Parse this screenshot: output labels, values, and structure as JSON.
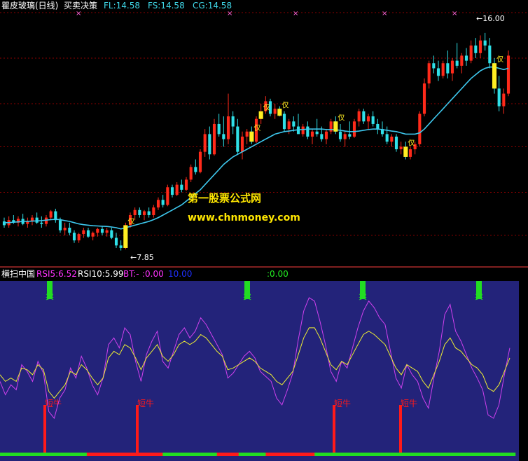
{
  "colors": {
    "background": "#000000",
    "lower_background": "#23237a",
    "grid": "#8b0000",
    "divider": "#ff4040",
    "up_candle": "#ff2a1a",
    "down_candle": "#2fe0e8",
    "ma_line": "#3ec8ee",
    "signal_bar": "#ffee22",
    "signal_text": "#ffee22",
    "sell_bar": "#22dd22",
    "buy_bar": "#ff1a1a",
    "rsi5_line": "#d040ee",
    "rsi10_line": "#eeee33",
    "label_white": "#ffffff",
    "label_cyan": "#3fd7e8",
    "label_magenta": "#ff33ff",
    "label_blue": "#1f2fff",
    "label_green": "#22ee22",
    "watermark_yellow": "#ffe600",
    "marker_pink": "#ff66dd"
  },
  "top_header": {
    "title": "瞿皮玻璃(日线)",
    "indicator": "买卖决策",
    "fl": "FL:14.58",
    "fs": "FS:14.58",
    "cg": "CG:14.58"
  },
  "bottom_header": {
    "title": "横扫中国",
    "rsi5": "RSI5:6.52",
    "rsi10": "RSI10:5.99",
    "bt_label": "BT:-",
    "bt_value": ":0.00",
    "blue_value": "10.00",
    "green_value": ":0.00"
  },
  "annotations": {
    "high_price": "16.00",
    "low_price": "7.85",
    "signal_char": "仅",
    "sell_label": "卖",
    "buy_label": "短牛",
    "watermark_cn": "第一股票公式网",
    "watermark_url": "www.chnmoney.com",
    "top_marker": "×"
  },
  "chart_data": [
    {
      "type": "candlestick",
      "name": "price",
      "ylim": [
        7.0,
        16.8
      ],
      "hlines": [
        8.0,
        9.7,
        11.5,
        13.2,
        15.0,
        16.8
      ],
      "candles": [
        {
          "o": 8.55,
          "h": 8.7,
          "l": 8.3,
          "c": 8.4
        },
        {
          "o": 8.4,
          "h": 8.75,
          "l": 8.3,
          "c": 8.6
        },
        {
          "o": 8.6,
          "h": 8.8,
          "l": 8.45,
          "c": 8.5
        },
        {
          "o": 8.5,
          "h": 8.75,
          "l": 8.35,
          "c": 8.65
        },
        {
          "o": 8.65,
          "h": 8.85,
          "l": 8.4,
          "c": 8.45
        },
        {
          "o": 8.45,
          "h": 8.7,
          "l": 8.3,
          "c": 8.55
        },
        {
          "o": 8.55,
          "h": 8.8,
          "l": 8.4,
          "c": 8.7
        },
        {
          "o": 8.7,
          "h": 8.9,
          "l": 8.45,
          "c": 8.5
        },
        {
          "o": 8.5,
          "h": 8.75,
          "l": 8.3,
          "c": 8.45
        },
        {
          "o": 8.45,
          "h": 8.8,
          "l": 8.35,
          "c": 8.7
        },
        {
          "o": 8.7,
          "h": 9.0,
          "l": 8.6,
          "c": 8.95
        },
        {
          "o": 8.95,
          "h": 9.05,
          "l": 8.5,
          "c": 8.6
        },
        {
          "o": 8.6,
          "h": 8.7,
          "l": 8.1,
          "c": 8.2
        },
        {
          "o": 8.2,
          "h": 8.5,
          "l": 8.0,
          "c": 8.3
        },
        {
          "o": 8.3,
          "h": 8.5,
          "l": 8.0,
          "c": 8.1
        },
        {
          "o": 8.1,
          "h": 8.2,
          "l": 7.7,
          "c": 7.8
        },
        {
          "o": 7.8,
          "h": 8.1,
          "l": 7.7,
          "c": 8.05
        },
        {
          "o": 8.05,
          "h": 8.3,
          "l": 7.9,
          "c": 8.2
        },
        {
          "o": 8.2,
          "h": 8.3,
          "l": 7.9,
          "c": 7.95
        },
        {
          "o": 7.95,
          "h": 8.15,
          "l": 7.8,
          "c": 8.1
        },
        {
          "o": 8.1,
          "h": 8.3,
          "l": 7.95,
          "c": 8.25
        },
        {
          "o": 8.25,
          "h": 8.35,
          "l": 8.0,
          "c": 8.1
        },
        {
          "o": 8.1,
          "h": 8.3,
          "l": 7.95,
          "c": 8.2
        },
        {
          "o": 8.2,
          "h": 8.3,
          "l": 7.85,
          "c": 7.9
        },
        {
          "o": 7.9,
          "h": 8.1,
          "l": 7.5,
          "c": 7.6
        },
        {
          "o": 7.6,
          "h": 7.8,
          "l": 7.4,
          "c": 7.5
        },
        {
          "o": 7.5,
          "h": 8.5,
          "l": 7.45,
          "c": 8.4
        },
        {
          "o": 8.4,
          "h": 8.9,
          "l": 8.3,
          "c": 8.8
        },
        {
          "o": 8.8,
          "h": 9.1,
          "l": 8.6,
          "c": 9.0
        },
        {
          "o": 9.0,
          "h": 9.1,
          "l": 8.7,
          "c": 8.8
        },
        {
          "o": 8.8,
          "h": 9.0,
          "l": 8.6,
          "c": 8.95
        },
        {
          "o": 8.95,
          "h": 9.1,
          "l": 8.7,
          "c": 8.8
        },
        {
          "o": 8.8,
          "h": 9.2,
          "l": 8.7,
          "c": 9.1
        },
        {
          "o": 9.1,
          "h": 9.5,
          "l": 9.0,
          "c": 9.4
        },
        {
          "o": 9.4,
          "h": 9.6,
          "l": 9.1,
          "c": 9.2
        },
        {
          "o": 9.2,
          "h": 10.0,
          "l": 9.15,
          "c": 9.9
        },
        {
          "o": 9.9,
          "h": 10.0,
          "l": 9.5,
          "c": 9.6
        },
        {
          "o": 9.6,
          "h": 10.1,
          "l": 9.55,
          "c": 10.0
        },
        {
          "o": 10.0,
          "h": 10.2,
          "l": 9.7,
          "c": 9.8
        },
        {
          "o": 9.8,
          "h": 10.3,
          "l": 9.75,
          "c": 10.2
        },
        {
          "o": 10.2,
          "h": 10.8,
          "l": 10.1,
          "c": 10.7
        },
        {
          "o": 10.7,
          "h": 11.0,
          "l": 10.4,
          "c": 10.5
        },
        {
          "o": 10.5,
          "h": 11.4,
          "l": 10.45,
          "c": 11.3
        },
        {
          "o": 11.3,
          "h": 12.2,
          "l": 11.1,
          "c": 12.0
        },
        {
          "o": 12.0,
          "h": 12.3,
          "l": 11.0,
          "c": 11.2
        },
        {
          "o": 11.2,
          "h": 12.6,
          "l": 11.15,
          "c": 12.4
        },
        {
          "o": 12.4,
          "h": 12.8,
          "l": 11.9,
          "c": 12.0
        },
        {
          "o": 12.0,
          "h": 12.7,
          "l": 11.5,
          "c": 11.8
        },
        {
          "o": 11.8,
          "h": 13.6,
          "l": 11.6,
          "c": 12.7
        },
        {
          "o": 12.7,
          "h": 12.9,
          "l": 12.0,
          "c": 12.3
        },
        {
          "o": 12.3,
          "h": 12.6,
          "l": 11.2,
          "c": 11.3
        },
        {
          "o": 11.3,
          "h": 12.1,
          "l": 11.0,
          "c": 11.9
        },
        {
          "o": 11.9,
          "h": 12.2,
          "l": 11.6,
          "c": 12.1
        },
        {
          "o": 12.1,
          "h": 12.3,
          "l": 11.6,
          "c": 11.7
        },
        {
          "o": 11.7,
          "h": 12.7,
          "l": 11.65,
          "c": 12.6
        },
        {
          "o": 12.6,
          "h": 13.2,
          "l": 12.4,
          "c": 12.9
        },
        {
          "o": 12.9,
          "h": 13.5,
          "l": 12.8,
          "c": 13.3
        },
        {
          "o": 13.3,
          "h": 13.4,
          "l": 12.7,
          "c": 12.8
        },
        {
          "o": 12.8,
          "h": 13.2,
          "l": 12.6,
          "c": 13.0
        },
        {
          "o": 13.0,
          "h": 13.1,
          "l": 12.7,
          "c": 12.8
        },
        {
          "o": 12.8,
          "h": 12.9,
          "l": 12.1,
          "c": 12.2
        },
        {
          "o": 12.2,
          "h": 12.6,
          "l": 12.0,
          "c": 12.5
        },
        {
          "o": 12.5,
          "h": 12.7,
          "l": 12.1,
          "c": 12.3
        },
        {
          "o": 12.3,
          "h": 12.8,
          "l": 12.2,
          "c": 12.0
        },
        {
          "o": 12.0,
          "h": 12.4,
          "l": 11.9,
          "c": 12.3
        },
        {
          "o": 12.3,
          "h": 12.5,
          "l": 11.8,
          "c": 11.9
        },
        {
          "o": 11.9,
          "h": 12.2,
          "l": 11.6,
          "c": 12.1
        },
        {
          "o": 12.1,
          "h": 12.6,
          "l": 11.9,
          "c": 12.0
        },
        {
          "o": 12.0,
          "h": 12.3,
          "l": 11.7,
          "c": 11.8
        },
        {
          "o": 11.8,
          "h": 12.2,
          "l": 11.6,
          "c": 12.1
        },
        {
          "o": 12.1,
          "h": 12.6,
          "l": 12.0,
          "c": 12.5
        },
        {
          "o": 12.5,
          "h": 12.7,
          "l": 12.0,
          "c": 12.1
        },
        {
          "o": 12.1,
          "h": 12.4,
          "l": 11.7,
          "c": 11.8
        },
        {
          "o": 11.8,
          "h": 12.1,
          "l": 11.5,
          "c": 12.0
        },
        {
          "o": 12.0,
          "h": 12.5,
          "l": 11.8,
          "c": 11.9
        },
        {
          "o": 11.9,
          "h": 12.6,
          "l": 11.85,
          "c": 12.5
        },
        {
          "o": 12.5,
          "h": 13.0,
          "l": 12.3,
          "c": 12.9
        },
        {
          "o": 12.9,
          "h": 13.0,
          "l": 12.4,
          "c": 12.5
        },
        {
          "o": 12.5,
          "h": 12.8,
          "l": 12.2,
          "c": 12.7
        },
        {
          "o": 12.7,
          "h": 12.9,
          "l": 12.3,
          "c": 12.4
        },
        {
          "o": 12.4,
          "h": 12.6,
          "l": 12.0,
          "c": 12.2
        },
        {
          "o": 12.2,
          "h": 12.5,
          "l": 11.9,
          "c": 12.0
        },
        {
          "o": 12.0,
          "h": 12.3,
          "l": 11.6,
          "c": 11.7
        },
        {
          "o": 11.7,
          "h": 12.0,
          "l": 11.5,
          "c": 11.9
        },
        {
          "o": 11.9,
          "h": 12.0,
          "l": 11.3,
          "c": 11.4
        },
        {
          "o": 11.4,
          "h": 11.7,
          "l": 11.2,
          "c": 11.5
        },
        {
          "o": 11.5,
          "h": 11.7,
          "l": 11.0,
          "c": 11.1
        },
        {
          "o": 11.1,
          "h": 11.5,
          "l": 11.0,
          "c": 11.4
        },
        {
          "o": 11.4,
          "h": 11.7,
          "l": 11.2,
          "c": 11.6
        },
        {
          "o": 11.6,
          "h": 12.9,
          "l": 11.5,
          "c": 12.8
        },
        {
          "o": 12.8,
          "h": 14.2,
          "l": 12.7,
          "c": 14.0
        },
        {
          "o": 14.0,
          "h": 14.9,
          "l": 13.8,
          "c": 14.8
        },
        {
          "o": 14.8,
          "h": 15.1,
          "l": 14.4,
          "c": 14.6
        },
        {
          "o": 14.6,
          "h": 14.9,
          "l": 14.1,
          "c": 14.3
        },
        {
          "o": 14.3,
          "h": 14.9,
          "l": 14.2,
          "c": 14.8
        },
        {
          "o": 14.8,
          "h": 15.3,
          "l": 14.2,
          "c": 14.4
        },
        {
          "o": 14.4,
          "h": 15.0,
          "l": 14.1,
          "c": 14.9
        },
        {
          "o": 14.9,
          "h": 15.6,
          "l": 14.6,
          "c": 14.7
        },
        {
          "o": 14.7,
          "h": 15.2,
          "l": 14.4,
          "c": 15.1
        },
        {
          "o": 15.1,
          "h": 15.4,
          "l": 14.7,
          "c": 14.9
        },
        {
          "o": 14.9,
          "h": 15.7,
          "l": 14.8,
          "c": 15.5
        },
        {
          "o": 15.5,
          "h": 15.8,
          "l": 15.0,
          "c": 15.2
        },
        {
          "o": 15.2,
          "h": 15.9,
          "l": 15.0,
          "c": 15.7
        },
        {
          "o": 15.7,
          "h": 16.0,
          "l": 15.3,
          "c": 15.5
        },
        {
          "o": 15.5,
          "h": 15.8,
          "l": 14.6,
          "c": 14.8
        },
        {
          "o": 14.8,
          "h": 15.0,
          "l": 13.6,
          "c": 13.8
        },
        {
          "o": 13.8,
          "h": 14.3,
          "l": 12.9,
          "c": 13.1
        },
        {
          "o": 13.1,
          "h": 13.8,
          "l": 12.8,
          "c": 13.6
        },
        {
          "o": 13.6,
          "h": 15.3,
          "l": 13.5,
          "c": 15.1
        }
      ],
      "ma": [
        8.5,
        8.5,
        8.52,
        8.53,
        8.55,
        8.55,
        8.56,
        8.57,
        8.58,
        8.6,
        8.62,
        8.63,
        8.62,
        8.58,
        8.55,
        8.5,
        8.45,
        8.42,
        8.4,
        8.38,
        8.37,
        8.36,
        8.35,
        8.33,
        8.3,
        8.25,
        8.3,
        8.35,
        8.4,
        8.45,
        8.5,
        8.55,
        8.62,
        8.7,
        8.8,
        8.9,
        9.0,
        9.1,
        9.2,
        9.35,
        9.5,
        9.65,
        9.8,
        10.0,
        10.2,
        10.4,
        10.6,
        10.8,
        10.95,
        11.1,
        11.2,
        11.3,
        11.4,
        11.5,
        11.6,
        11.7,
        11.8,
        11.9,
        12.0,
        12.05,
        12.1,
        12.12,
        12.15,
        12.17,
        12.18,
        12.2,
        12.2,
        12.2,
        12.2,
        12.18,
        12.18,
        12.17,
        12.15,
        12.12,
        12.1,
        12.1,
        12.12,
        12.15,
        12.18,
        12.2,
        12.2,
        12.18,
        12.15,
        12.12,
        12.1,
        12.05,
        12.0,
        12.0,
        12.0,
        12.05,
        12.2,
        12.4,
        12.6,
        12.8,
        13.0,
        13.2,
        13.4,
        13.6,
        13.8,
        14.0,
        14.2,
        14.35,
        14.5,
        14.6,
        14.65,
        14.65,
        14.6,
        14.55,
        14.6
      ],
      "signal_bars": [
        26,
        53,
        55,
        59,
        71,
        86,
        105
      ],
      "high_price_label_index": 103,
      "low_price_label_index": 25
    },
    {
      "type": "line",
      "name": "oscillator",
      "ylim": [
        0,
        100
      ],
      "series": [
        {
          "name": "RSI5",
          "values": [
            40,
            32,
            38,
            35,
            50,
            46,
            40,
            52,
            45,
            22,
            18,
            30,
            35,
            48,
            42,
            55,
            48,
            38,
            32,
            42,
            62,
            66,
            60,
            72,
            68,
            52,
            40,
            56,
            64,
            70,
            52,
            48,
            58,
            68,
            72,
            66,
            70,
            78,
            74,
            68,
            62,
            56,
            42,
            45,
            50,
            55,
            58,
            54,
            46,
            43,
            40,
            30,
            26,
            35,
            45,
            65,
            82,
            90,
            88,
            76,
            62,
            46,
            40,
            52,
            48,
            60,
            72,
            82,
            88,
            84,
            78,
            74,
            58,
            42,
            36,
            50,
            44,
            40,
            30,
            24,
            42,
            58,
            80,
            86,
            70,
            64,
            56,
            48,
            42,
            35,
            20,
            18,
            26,
            44,
            60
          ]
        },
        {
          "name": "RSI10",
          "values": [
            44,
            40,
            42,
            40,
            48,
            47,
            44,
            50,
            47,
            34,
            30,
            34,
            38,
            46,
            44,
            50,
            47,
            42,
            38,
            42,
            54,
            58,
            56,
            62,
            60,
            54,
            47,
            54,
            58,
            62,
            55,
            52,
            56,
            62,
            64,
            62,
            64,
            68,
            66,
            62,
            58,
            55,
            47,
            48,
            50,
            52,
            54,
            52,
            48,
            46,
            44,
            40,
            38,
            42,
            46,
            56,
            66,
            72,
            72,
            66,
            58,
            50,
            47,
            52,
            50,
            56,
            62,
            68,
            70,
            68,
            65,
            62,
            55,
            48,
            44,
            50,
            48,
            46,
            40,
            36,
            44,
            52,
            62,
            66,
            60,
            58,
            54,
            50,
            48,
            44,
            36,
            34,
            38,
            46,
            54
          ]
        }
      ],
      "sell_signals": [
        5,
        30,
        46,
        56
      ],
      "buy_signals": [
        5,
        16,
        40,
        49
      ],
      "bottom_bar_red_ranges": [
        [
          16,
          29
        ],
        [
          40,
          43
        ],
        [
          49,
          57
        ]
      ]
    }
  ]
}
